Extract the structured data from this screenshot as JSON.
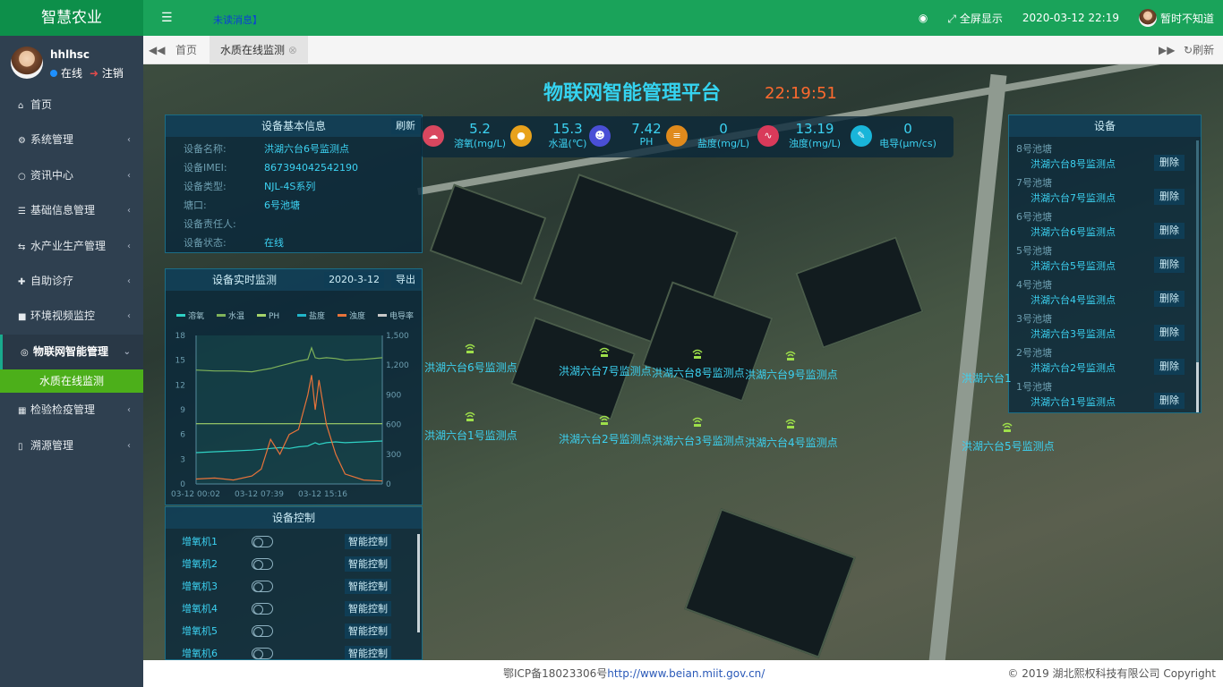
{
  "app": {
    "title": "智慧农业"
  },
  "topbar": {
    "unread": "未读消息】",
    "fullscreen": "全屏显示",
    "datetime": "2020-03-12 22:19",
    "username": "暂时不知道"
  },
  "profile": {
    "name": "hhlhsc",
    "status": "在线",
    "logout": "注销"
  },
  "sidebar": {
    "items": [
      {
        "icon": "home-icon",
        "label": "首页"
      },
      {
        "icon": "gear-icon",
        "label": "系统管理"
      },
      {
        "icon": "chat-icon",
        "label": "资讯中心"
      },
      {
        "icon": "list-icon",
        "label": "基础信息管理"
      },
      {
        "icon": "exchange-icon",
        "label": "水产业生产管理"
      },
      {
        "icon": "plus-icon",
        "label": "自助诊疗"
      },
      {
        "icon": "video-icon",
        "label": "环境视频监控"
      },
      {
        "icon": "globe-icon",
        "label": "物联网智能管理"
      },
      {
        "icon": "calendar-icon",
        "label": "检验检疫管理"
      },
      {
        "icon": "barcode-icon",
        "label": "溯源管理"
      }
    ],
    "submenu_active": "水质在线监测"
  },
  "tabs": {
    "home": "首页",
    "active": "水质在线监测",
    "refresh": "刷新"
  },
  "platform": {
    "title": "物联网智能管理平台",
    "clock": "22:19:51"
  },
  "device_info": {
    "title": "设备基本信息",
    "refresh": "刷新",
    "rows": [
      {
        "k": "设备名称:",
        "v": "洪湖六台6号监测点"
      },
      {
        "k": "设备IMEI:",
        "v": "867394042542190"
      },
      {
        "k": "设备类型:",
        "v": "NJL-4S系列"
      },
      {
        "k": "塘口:",
        "v": "6号池塘"
      },
      {
        "k": "设备责任人:",
        "v": ""
      },
      {
        "k": "设备状态:",
        "v": "在线"
      }
    ]
  },
  "sensors": [
    {
      "value": "5.2",
      "label": "溶氧(mg/L)",
      "color": "#d9475f"
    },
    {
      "value": "15.3",
      "label": "水温(℃)",
      "color": "#e8a21c"
    },
    {
      "value": "7.42",
      "label": "PH",
      "color": "#4a4fd6"
    },
    {
      "value": "0",
      "label": "盐度(mg/L)",
      "color": "#e08a1c"
    },
    {
      "value": "13.19",
      "label": "浊度(mg/L)",
      "color": "#d93a5a"
    },
    {
      "value": "0",
      "label": "电导(μm/cs)",
      "color": "#19b5d9"
    }
  ],
  "realtime": {
    "title": "设备实时监测",
    "date": "2020-3-12",
    "export": "导出"
  },
  "chart_data": {
    "type": "line",
    "legend": [
      {
        "name": "溶氧",
        "color": "#2fd1c4"
      },
      {
        "name": "水温",
        "color": "#7fb35a"
      },
      {
        "name": "PH",
        "color": "#a5d46a"
      },
      {
        "name": "盐度",
        "color": "#20b5c9"
      },
      {
        "name": "浊度",
        "color": "#e8733a"
      },
      {
        "name": "电导率",
        "color": "#c8c8c8"
      }
    ],
    "left_ticks": [
      "18",
      "15",
      "12",
      "9",
      "6",
      "3",
      "0"
    ],
    "right_ticks": [
      "1,500",
      "1,200",
      "900",
      "600",
      "300",
      "0"
    ],
    "x_ticks": [
      "03-12 00:02",
      "03-12 07:39",
      "03-12 15:16"
    ],
    "ylim_left": [
      0,
      18
    ],
    "ylim_right": [
      0,
      1500
    ],
    "x": [
      0,
      0.1,
      0.2,
      0.3,
      0.35,
      0.4,
      0.45,
      0.5,
      0.55,
      0.6,
      0.62,
      0.64,
      0.66,
      0.7,
      0.75,
      0.8,
      0.9,
      1.0
    ],
    "series": [
      {
        "name": "水温",
        "axis": "left",
        "values": [
          13.8,
          13.7,
          13.7,
          13.6,
          13.8,
          14.0,
          14.3,
          14.6,
          14.9,
          15.1,
          16.5,
          15.3,
          15.2,
          15.3,
          15.2,
          15.0,
          15.1,
          15.3
        ]
      },
      {
        "name": "PH",
        "axis": "left",
        "values": [
          7.3,
          7.3,
          7.3,
          7.3,
          7.3,
          7.3,
          7.3,
          7.3,
          7.3,
          7.3,
          7.3,
          7.3,
          7.3,
          7.3,
          7.3,
          7.3,
          7.3,
          7.3
        ]
      },
      {
        "name": "溶氧",
        "axis": "left",
        "values": [
          3.8,
          3.9,
          4.0,
          4.1,
          4.2,
          4.3,
          4.4,
          4.3,
          4.5,
          4.6,
          4.8,
          5.0,
          4.8,
          5.0,
          5.1,
          5.0,
          5.1,
          5.2
        ]
      },
      {
        "name": "浊度",
        "axis": "right",
        "values": [
          50,
          60,
          40,
          80,
          150,
          450,
          300,
          500,
          550,
          900,
          1100,
          750,
          1050,
          600,
          300,
          100,
          40,
          30
        ]
      }
    ]
  },
  "control": {
    "title": "设备控制",
    "rows": [
      {
        "name": "增氧机1",
        "btn": "智能控制"
      },
      {
        "name": "增氧机2",
        "btn": "智能控制"
      },
      {
        "name": "增氧机3",
        "btn": "智能控制"
      },
      {
        "name": "增氧机4",
        "btn": "智能控制"
      },
      {
        "name": "增氧机5",
        "btn": "智能控制"
      },
      {
        "name": "增氧机6",
        "btn": "智能控制"
      }
    ]
  },
  "devices": {
    "title": "设备",
    "groups": [
      {
        "pond": "8号池塘",
        "point": "洪湖六台8号监测点",
        "del": "删除"
      },
      {
        "pond": "7号池塘",
        "point": "洪湖六台7号监测点",
        "del": "删除"
      },
      {
        "pond": "6号池塘",
        "point": "洪湖六台6号监测点",
        "del": "删除"
      },
      {
        "pond": "5号池塘",
        "point": "洪湖六台5号监测点",
        "del": "删除"
      },
      {
        "pond": "4号池塘",
        "point": "洪湖六台4号监测点",
        "del": "删除"
      },
      {
        "pond": "3号池塘",
        "point": "洪湖六台3号监测点",
        "del": "删除"
      },
      {
        "pond": "2号池塘",
        "point": "洪湖六台2号监测点",
        "del": "删除"
      },
      {
        "pond": "1号池塘",
        "point": "洪湖六台1号监测点",
        "del": "删除"
      }
    ]
  },
  "map_markers": [
    {
      "label": "洪湖六台6号监测点"
    },
    {
      "label": "洪湖六台7号监测点"
    },
    {
      "label": "洪湖六台8号监测点"
    },
    {
      "label": "洪湖六台9号监测点"
    },
    {
      "label": "洪湖六台1"
    },
    {
      "label": "洪湖六台1号监测点"
    },
    {
      "label": "洪湖六台2号监测点"
    },
    {
      "label": "洪湖六台3号监测点"
    },
    {
      "label": "洪湖六台4号监测点"
    },
    {
      "label": "洪湖六台5号监测点"
    }
  ],
  "footer": {
    "icp": "鄂ICP备18023306号",
    "link": "http://www.beian.miit.gov.cn/",
    "copyright": "© 2019 湖北熙权科技有限公司 Copyright"
  }
}
